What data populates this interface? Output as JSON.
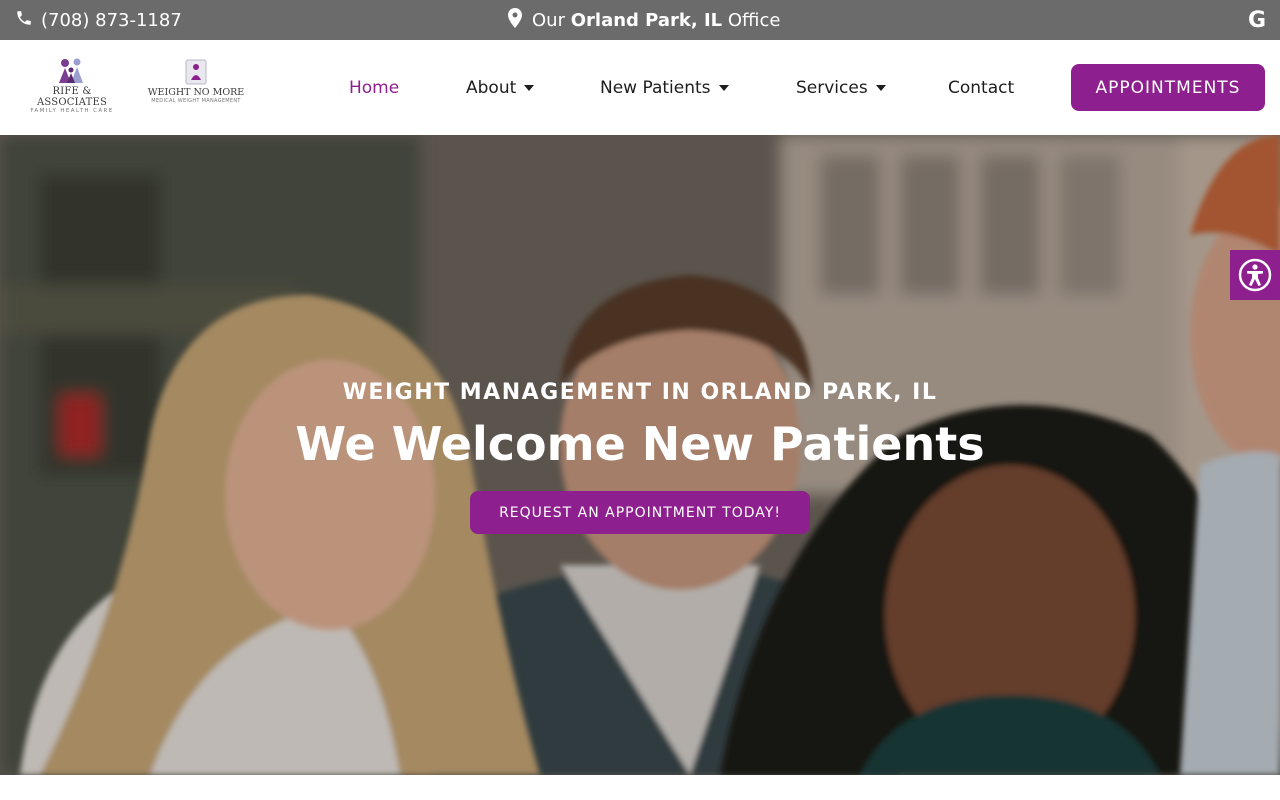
{
  "topbar": {
    "phone": "(708) 873-1187",
    "office_prefix": "Our",
    "office_location": "Orland Park, IL",
    "office_suffix": "Office",
    "google_letter": "G",
    "icons": [
      "phone-icon",
      "map-marker-icon",
      "google-icon"
    ]
  },
  "logos": {
    "primary": {
      "name": "RIFE & ASSOCIATES",
      "tagline": "FAMILY HEALTH CARE"
    },
    "secondary": {
      "name": "WEIGHT NO MORE",
      "tagline": "MEDICAL WEIGHT MANAGEMENT"
    }
  },
  "nav": {
    "home": "Home",
    "about": "About",
    "new_patients": "New Patients",
    "services": "Services",
    "contact": "Contact"
  },
  "appointments_button": "APPOINTMENTS",
  "hero": {
    "subtitle": "WEIGHT MANAGEMENT IN ORLAND PARK, IL",
    "title": "We Welcome New Patients",
    "cta": "REQUEST AN APPOINTMENT TODAY!"
  },
  "colors": {
    "accent": "#8e1f8e",
    "topbar": "#6b6b6b",
    "nav_active": "#8e1f8e"
  }
}
